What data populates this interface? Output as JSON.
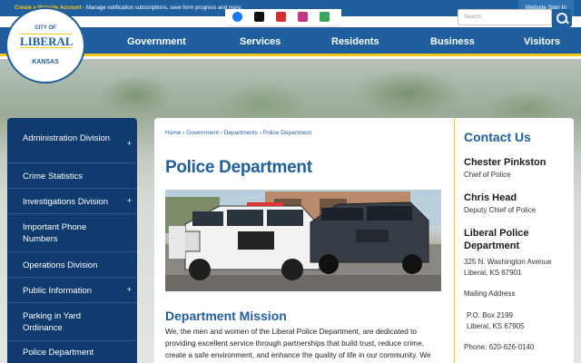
{
  "topbar": {
    "notice_link": "Create a Website Account",
    "notice_text": " - Manage notification subscriptions, save form progress and more.",
    "signin_label": "Website Sign In"
  },
  "search": {
    "placeholder": "Search"
  },
  "logo": {
    "city_of": "CITY OF",
    "name": "LIBERAL",
    "state": "KANSAS"
  },
  "nav": {
    "items": [
      "Government",
      "Services",
      "Residents",
      "Business",
      "Visitors"
    ]
  },
  "sidebar": {
    "items": [
      {
        "label": "Administration Division",
        "expand": "+"
      },
      {
        "label": "Crime Statistics"
      },
      {
        "label": "Investigations Division",
        "expand": "+"
      },
      {
        "label": "Important Phone Numbers"
      },
      {
        "label": "Operations Division"
      },
      {
        "label": "Public Information",
        "expand": "+"
      },
      {
        "label": "Parking in Yard Ordinance"
      },
      {
        "label": "Police Department"
      }
    ]
  },
  "breadcrumb": {
    "items": [
      "Home",
      "Government",
      "Departments",
      "Police Department"
    ],
    "separator": "›"
  },
  "main": {
    "title": "Police Department",
    "section_title": "Department Mission",
    "body": "We, the men and women of the Liberal Police Department, are dedicated to providing excellent service through partnerships that build trust, reduce crime, create a safe environment, and enhance the quality of life in our community. We are committed to these principles:"
  },
  "contact": {
    "title": "Contact Us",
    "person1_name": "Chester Pinkston",
    "person1_role": "Chief of Police",
    "person2_name": "Chris Head",
    "person2_role": "Deputy Chief of Police",
    "org_name": "Liberal Police Department",
    "address1": "325 N. Washington Avenue",
    "address2": "Liberal, KS 67901",
    "mailing_label": "Mailing Address",
    "po1": "P.O. Box 2199",
    "po2": "Liberal, KS 67905",
    "phone": "Phone: 620-626-0140"
  },
  "colors": {
    "brand_blue": "#1f5f9e",
    "accent_yellow": "#f5c518",
    "sidebar_navy": "#0f3b6e"
  },
  "icons": [
    "facebook-icon",
    "twitter-x-icon",
    "youtube-icon",
    "instagram-icon",
    "nextdoor-icon",
    "search-icon"
  ]
}
